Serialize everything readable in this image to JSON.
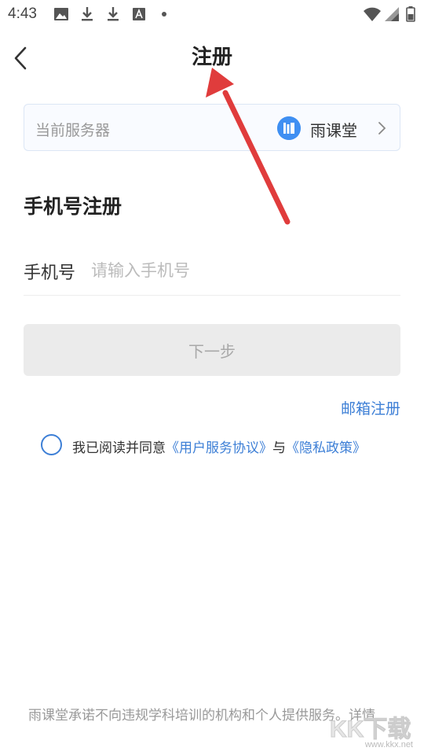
{
  "status_bar": {
    "time": "4:43"
  },
  "header": {
    "title": "注册"
  },
  "server": {
    "label": "当前服务器",
    "name": "雨课堂"
  },
  "form": {
    "section_title": "手机号注册",
    "phone_label": "手机号",
    "phone_placeholder": "请输入手机号",
    "phone_value": "",
    "next_label": "下一步",
    "email_link": "邮箱注册"
  },
  "agreement": {
    "prefix": "我已阅读并同意",
    "terms": "《用户服务协议》",
    "conj": "与",
    "privacy": "《隐私政策》"
  },
  "footer": {
    "text": "雨课堂承诺不向违规学科培训的机构和个人提供服务。详情"
  },
  "watermark": {
    "domain": "www.kkx.net",
    "logo_text": "KK下载"
  },
  "colors": {
    "accent": "#3d7fd6",
    "arrow": "#e03c3c",
    "button_bg": "#ebebeb"
  }
}
